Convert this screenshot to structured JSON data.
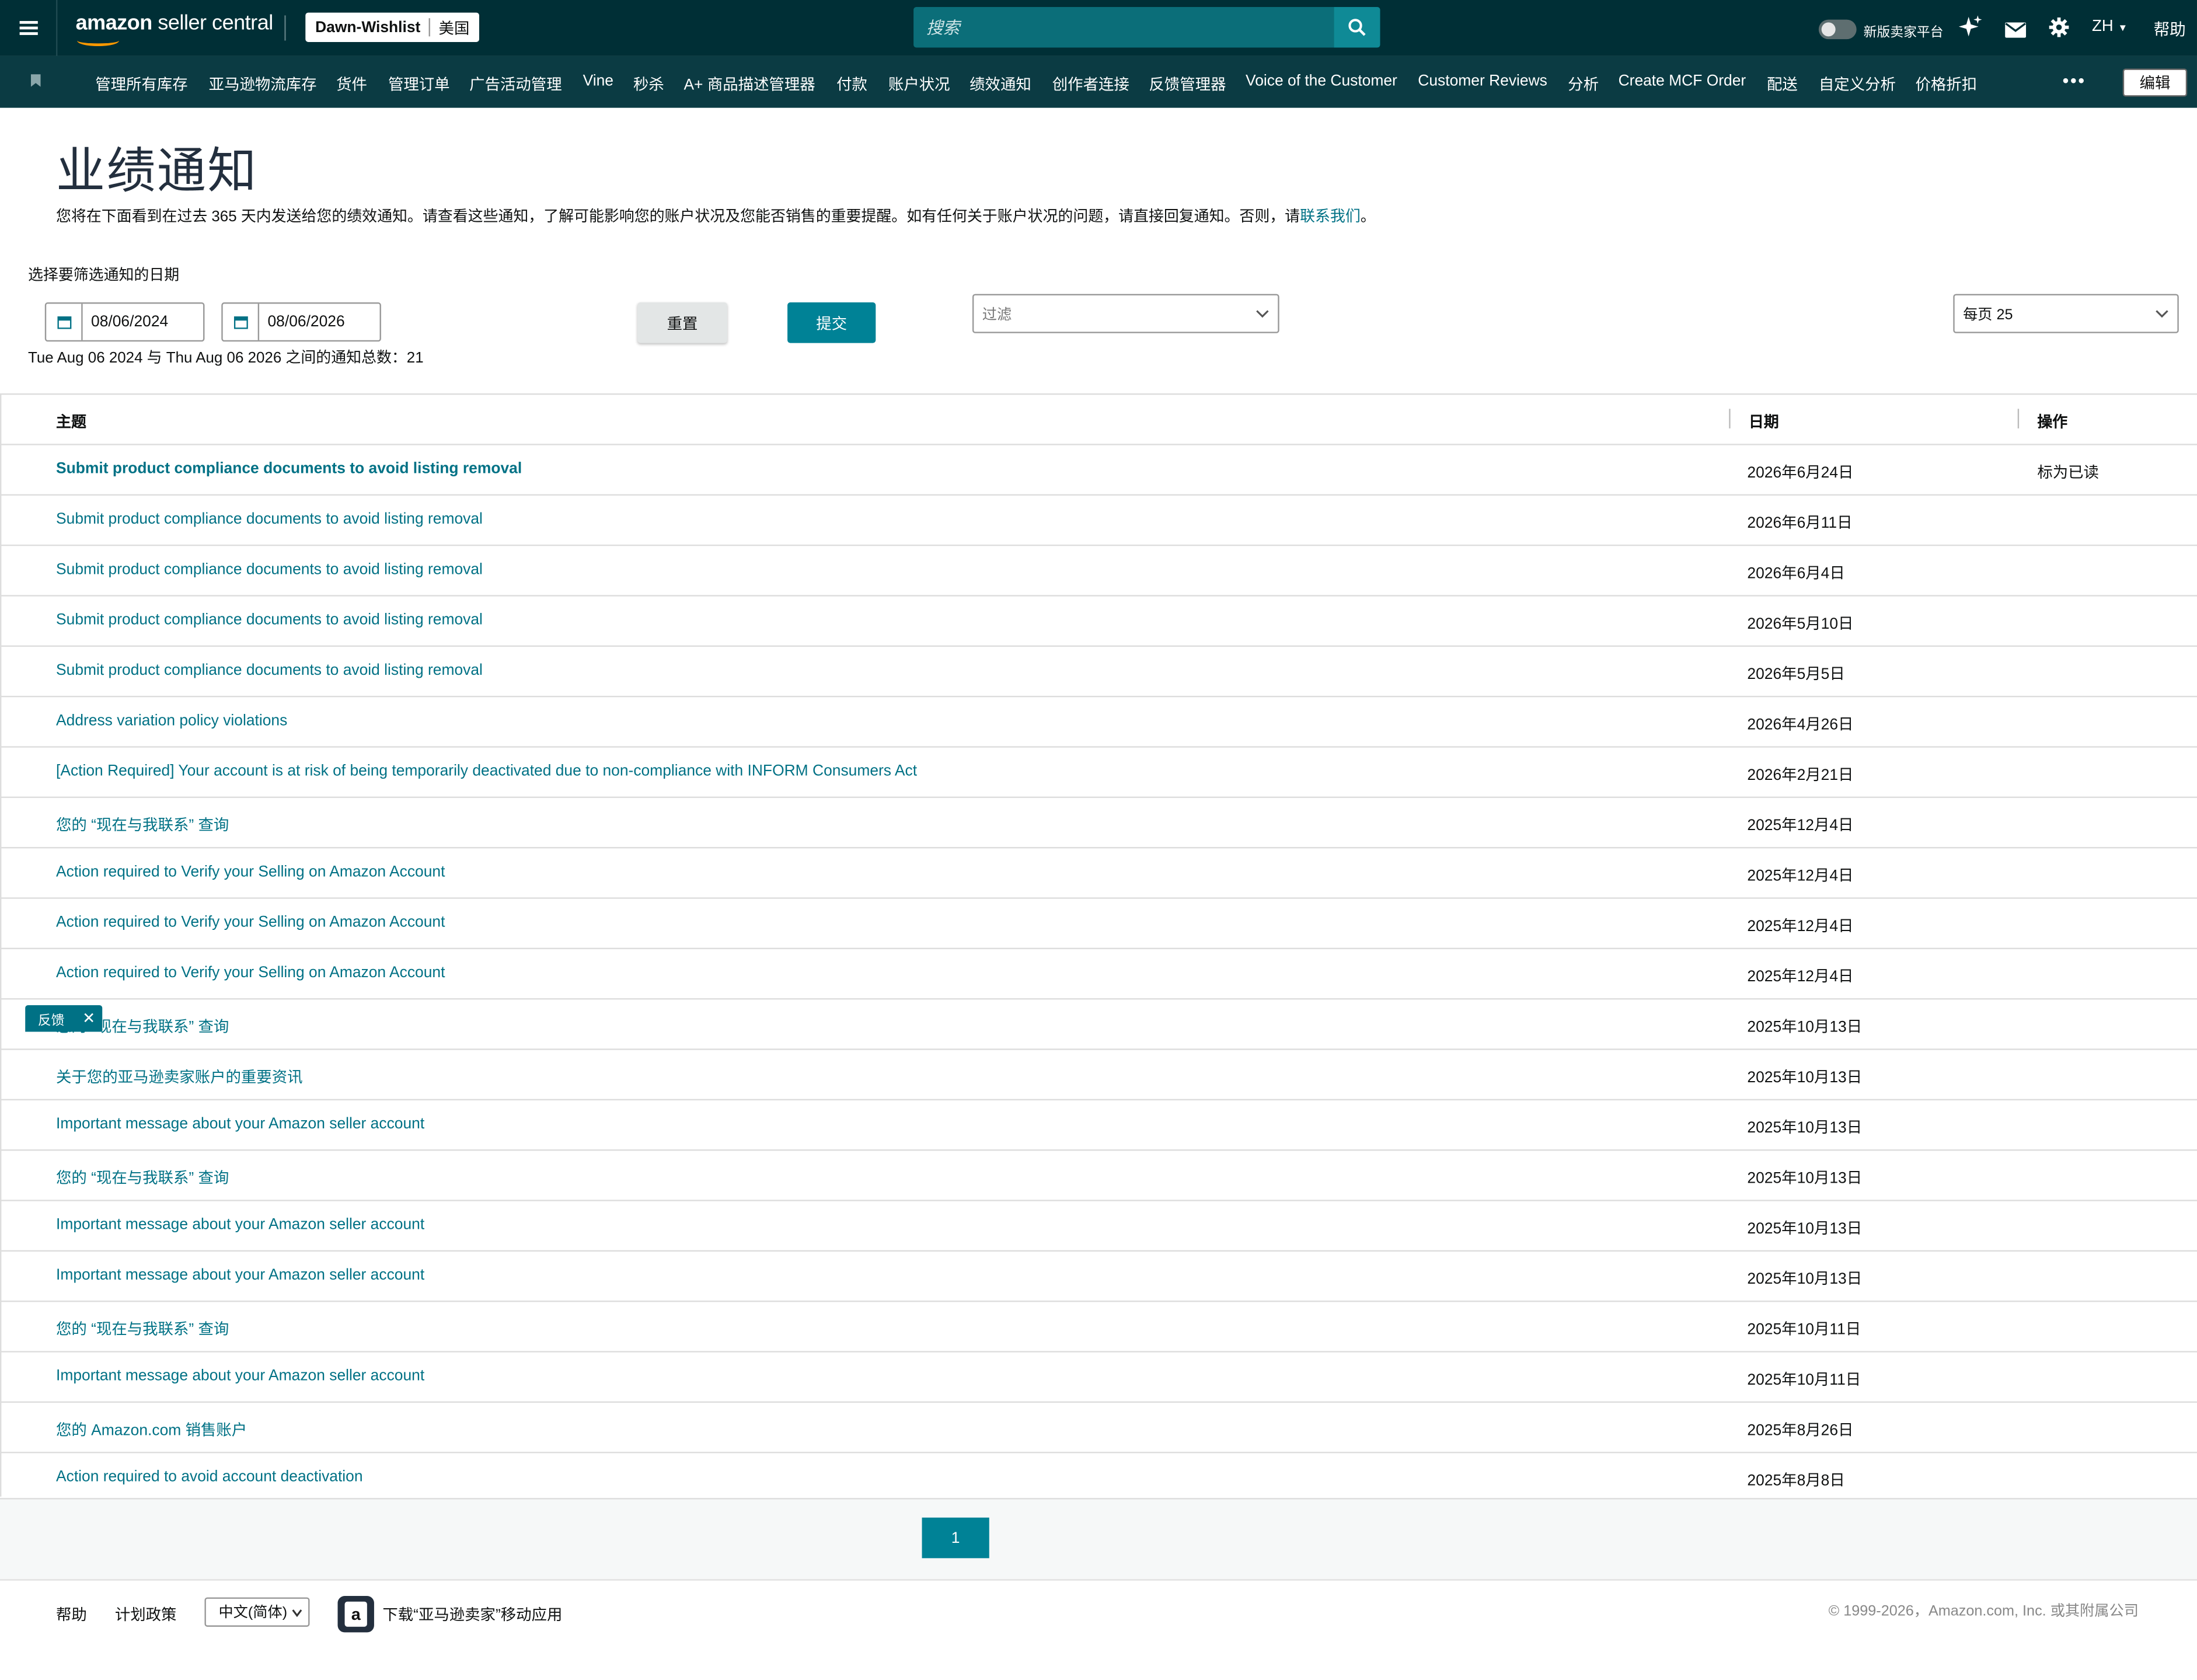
{
  "topbar": {
    "logo_bold": "amazon",
    "logo_rest": " seller central",
    "store_name": "Dawn-Wishlist",
    "store_region": "美国",
    "search_placeholder": "搜索",
    "new_platform_label": "新版卖家平台",
    "language": "ZH",
    "help": "帮助"
  },
  "nav": {
    "items": [
      "管理所有库存",
      "亚马逊物流库存",
      "货件",
      "管理订单",
      "广告活动管理",
      "Vine",
      "秒杀",
      "A+ 商品描述管理器",
      "付款",
      "账户状况",
      "绩效通知",
      "创作者连接",
      "反馈管理器",
      "Voice of the Customer",
      "Customer Reviews",
      "分析",
      "Create MCF Order",
      "配送",
      "自定义分析",
      "价格折扣"
    ],
    "more": "•••",
    "edit": "编辑"
  },
  "page": {
    "title": "业绩通知",
    "description": "您将在下面看到在过去 365 天内发送给您的绩效通知。请查看这些通知，了解可能影响您的账户状况及您能否销售的重要提醒。如有任何关于账户状况的问题，请直接回复通知。否则，请",
    "contact_link": "联系我们",
    "description_end": "。"
  },
  "filters": {
    "label": "选择要筛选通知的日期",
    "start_date": "08/06/2024",
    "end_date": "08/06/2026",
    "reset": "重置",
    "submit": "提交",
    "filter_placeholder": "过滤",
    "per_page": "每页 25",
    "count_text": "Tue Aug 06 2024 与 Thu Aug 06 2026 之间的通知总数：21"
  },
  "table": {
    "headers": {
      "subject": "主题",
      "date": "日期",
      "action": "操作"
    },
    "rows": [
      {
        "subject": "Submit product compliance documents to avoid listing removal",
        "date": "2026年6月24日",
        "action": "标为已读",
        "unread": true
      },
      {
        "subject": "Submit product compliance documents to avoid listing removal",
        "date": "2026年6月11日",
        "action": ""
      },
      {
        "subject": "Submit product compliance documents to avoid listing removal",
        "date": "2026年6月4日",
        "action": ""
      },
      {
        "subject": "Submit product compliance documents to avoid listing removal",
        "date": "2026年5月10日",
        "action": ""
      },
      {
        "subject": "Submit product compliance documents to avoid listing removal",
        "date": "2026年5月5日",
        "action": ""
      },
      {
        "subject": "Address variation policy violations",
        "date": "2026年4月26日",
        "action": ""
      },
      {
        "subject": "[Action Required] Your account is at risk of being temporarily deactivated due to non-compliance with INFORM Consumers Act",
        "date": "2026年2月21日",
        "action": ""
      },
      {
        "subject": "您的 “现在与我联系” 查询",
        "date": "2025年12月4日",
        "action": ""
      },
      {
        "subject": "Action required to Verify your Selling on Amazon Account",
        "date": "2025年12月4日",
        "action": ""
      },
      {
        "subject": "Action required to Verify your Selling on Amazon Account",
        "date": "2025年12月4日",
        "action": ""
      },
      {
        "subject": "Action required to Verify your Selling on Amazon Account",
        "date": "2025年12月4日",
        "action": ""
      },
      {
        "subject": "您的 “现在与我联系” 查询",
        "date": "2025年10月13日",
        "action": ""
      },
      {
        "subject": "关于您的亚马逊卖家账户的重要资讯",
        "date": "2025年10月13日",
        "action": ""
      },
      {
        "subject": "Important message about your Amazon seller account",
        "date": "2025年10月13日",
        "action": ""
      },
      {
        "subject": "您的 “现在与我联系” 查询",
        "date": "2025年10月13日",
        "action": ""
      },
      {
        "subject": "Important message about your Amazon seller account",
        "date": "2025年10月13日",
        "action": ""
      },
      {
        "subject": "Important message about your Amazon seller account",
        "date": "2025年10月13日",
        "action": ""
      },
      {
        "subject": "您的 “现在与我联系” 查询",
        "date": "2025年10月11日",
        "action": ""
      },
      {
        "subject": "Important message about your Amazon seller account",
        "date": "2025年10月11日",
        "action": ""
      },
      {
        "subject": "您的 Amazon.com 销售账户",
        "date": "2025年8月26日",
        "action": ""
      },
      {
        "subject": "Action required to avoid account deactivation",
        "date": "2025年8月8日",
        "action": ""
      }
    ]
  },
  "pagination": {
    "current": "1"
  },
  "feedback": {
    "label": "反馈",
    "close": "✕"
  },
  "footer": {
    "help": "帮助",
    "policies": "计划政策",
    "language": "中文(简体)",
    "app_download": "下载“亚马逊卖家”移动应用",
    "copyright": "© 1999-2026，Amazon.com, Inc. 或其附属公司"
  },
  "colors": {
    "topbar": "#002f36",
    "navbar": "#0b3b43",
    "link": "#007185",
    "primary": "#008296"
  }
}
